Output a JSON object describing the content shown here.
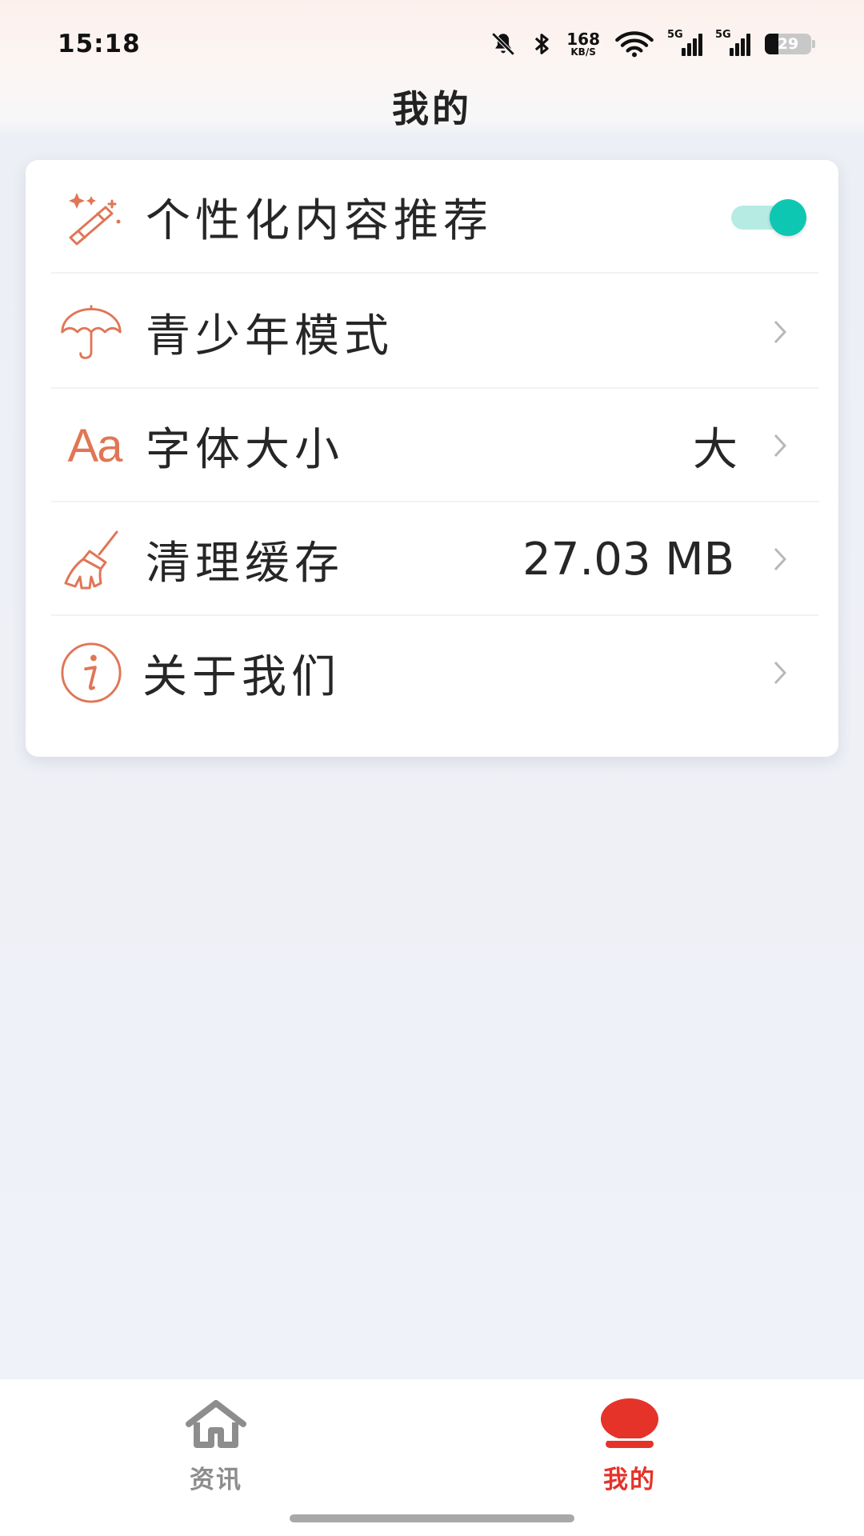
{
  "status_bar": {
    "time": "15:18",
    "net_speed": "168",
    "net_speed_unit": "KB/S",
    "signal_1_tag": "5G",
    "signal_2_tag": "5G",
    "battery": "29",
    "icons": [
      "mute-bell-icon",
      "bluetooth-icon",
      "wifi-icon",
      "signal-icon",
      "battery-icon"
    ]
  },
  "header": {
    "title": "我的"
  },
  "settings": {
    "items": [
      {
        "label": "个性化内容推荐",
        "icon": "magic-wand-icon",
        "control": "toggle",
        "enabled": true
      },
      {
        "label": "青少年模式",
        "icon": "umbrella-icon",
        "control": "chevron"
      },
      {
        "label": "字体大小",
        "icon": "font-size-icon",
        "value": "大",
        "control": "chevron",
        "icon_text": "Aa"
      },
      {
        "label": "清理缓存",
        "icon": "broom-icon",
        "value": "27.03 MB",
        "control": "chevron"
      },
      {
        "label": "关于我们",
        "icon": "info-icon",
        "control": "chevron"
      }
    ]
  },
  "bottom_nav": {
    "items": [
      {
        "label": "资讯",
        "icon": "home-icon",
        "active": false
      },
      {
        "label": "我的",
        "icon": "profile-icon",
        "active": true
      }
    ]
  },
  "colors": {
    "accent_icon": "#e07656",
    "toggle_on": "#0ec7b2",
    "nav_active": "#e5332a",
    "nav_inactive": "#8d8d8d"
  }
}
